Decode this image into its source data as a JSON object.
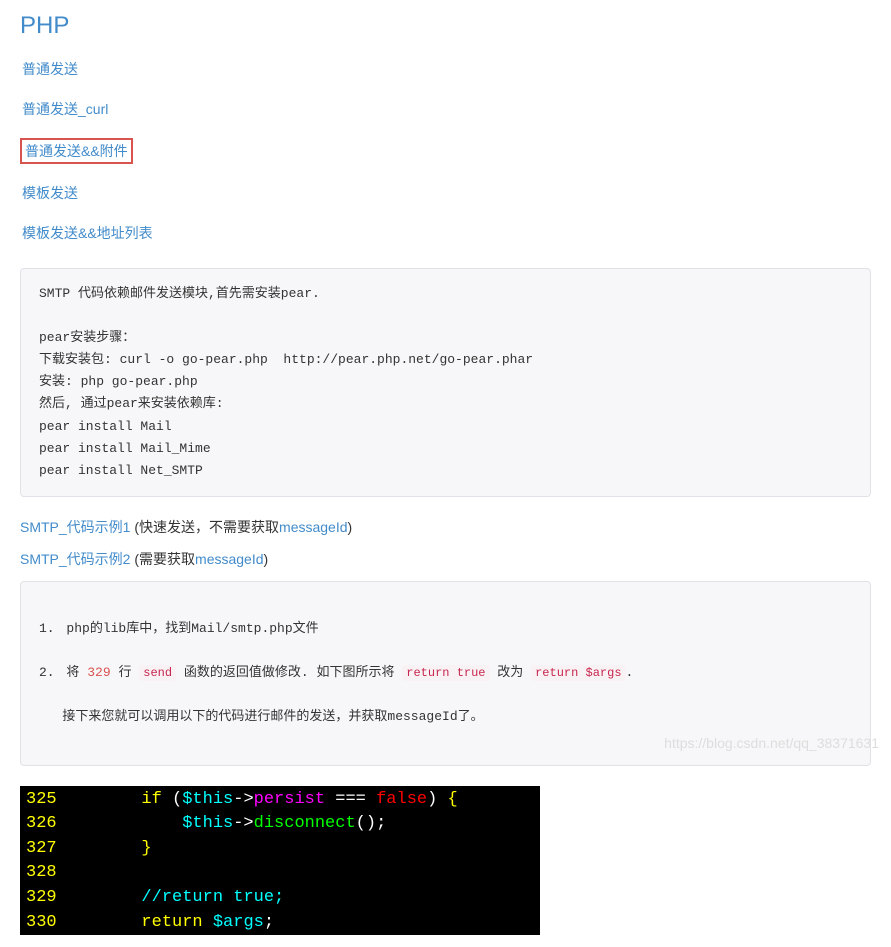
{
  "title": "PHP",
  "navLinks": [
    {
      "label": "普通发送",
      "highlighted": false
    },
    {
      "label": "普通发送_curl",
      "highlighted": false
    },
    {
      "label": "普通发送&&附件",
      "highlighted": true
    },
    {
      "label": "模板发送",
      "highlighted": false
    },
    {
      "label": "模板发送&&地址列表",
      "highlighted": false
    }
  ],
  "installBlock": "SMTP 代码依赖邮件发送模块,首先需安装pear.\n\npear安装步骤：\n下载安装包: curl -o go-pear.php  http://pear.php.net/go-pear.phar\n安装: php go-pear.php\n然后, 通过pear来安装依赖库:\npear install Mail\npear install Mail_Mime\npear install Net_SMTP",
  "examples": [
    {
      "label": "SMTP_代码示例1",
      "noteBefore": " (快速发送，不需要获取",
      "messageIdLabel": "messageId",
      "noteAfter": ")"
    },
    {
      "label": "SMTP_代码示例2",
      "noteBefore": " (需要获取",
      "messageIdLabel": "messageId",
      "noteAfter": ")"
    }
  ],
  "steps": {
    "item1": {
      "num": "1.",
      "text": "php的lib库中，找到Mail/smtp.php文件"
    },
    "item2": {
      "num": "2.",
      "p1": "将 ",
      "lineRef": "329",
      "p2": " 行 ",
      "code1": "send",
      "p3": " 函数的返回值做修改. 如下图所示将 ",
      "code2": "return true",
      "p4": " 改为 ",
      "code3": "return $args",
      "p5": "."
    },
    "item3": "   接下来您就可以调用以下的代码进行邮件的发送，并获取messageId了。"
  },
  "editor": {
    "lines": [
      {
        "gutter": "325",
        "segments": [
          {
            "cls": "kw-white",
            "t": "       "
          },
          {
            "cls": "kw-yellow",
            "t": "if "
          },
          {
            "cls": "kw-white",
            "t": "("
          },
          {
            "cls": "kw-cyan",
            "t": "$this"
          },
          {
            "cls": "kw-white",
            "t": "->"
          },
          {
            "cls": "kw-magenta",
            "t": "persist "
          },
          {
            "cls": "kw-white",
            "t": "=== "
          },
          {
            "cls": "kw-red",
            "t": "false"
          },
          {
            "cls": "kw-white",
            "t": ") "
          },
          {
            "cls": "kw-yellow",
            "t": "{"
          }
        ]
      },
      {
        "gutter": "326",
        "segments": [
          {
            "cls": "kw-white",
            "t": "           "
          },
          {
            "cls": "kw-cyan",
            "t": "$this"
          },
          {
            "cls": "kw-white",
            "t": "->"
          },
          {
            "cls": "kw-green",
            "t": "disconnect"
          },
          {
            "cls": "kw-white",
            "t": "();"
          }
        ]
      },
      {
        "gutter": "327",
        "segments": [
          {
            "cls": "kw-white",
            "t": "       "
          },
          {
            "cls": "kw-yellow",
            "t": "}"
          }
        ]
      },
      {
        "gutter": "328",
        "segments": [
          {
            "cls": "kw-white",
            "t": " "
          }
        ]
      },
      {
        "gutter": "329",
        "segments": [
          {
            "cls": "kw-white",
            "t": "       "
          },
          {
            "cls": "kw-cyan",
            "t": "//return true;"
          }
        ]
      },
      {
        "gutter": "330",
        "segments": [
          {
            "cls": "kw-white",
            "t": "       "
          },
          {
            "cls": "kw-yellow",
            "t": "return "
          },
          {
            "cls": "kw-cyan",
            "t": "$args"
          },
          {
            "cls": "kw-white",
            "t": ";"
          }
        ]
      }
    ]
  },
  "watermark": "https://blog.csdn.net/qq_38371631"
}
